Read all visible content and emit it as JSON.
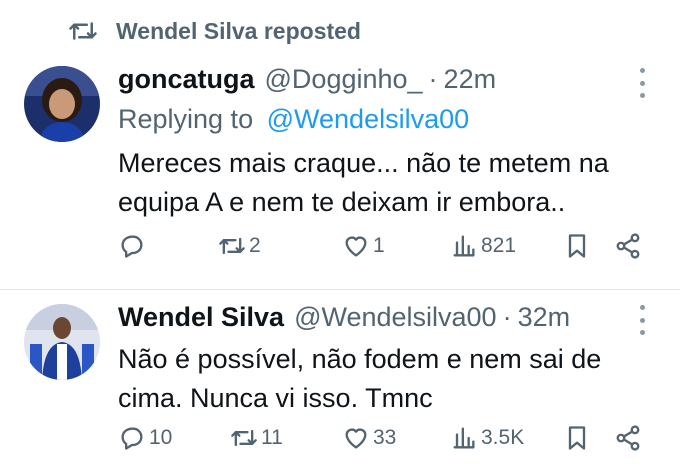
{
  "repost": {
    "text": "Wendel Silva reposted"
  },
  "tweets": [
    {
      "name": "goncatuga",
      "handle": "@Dogginho_",
      "separator": "·",
      "time": "22m",
      "replying_label": "Replying to",
      "replying_to": "@Wendelsilva00",
      "text_lines": [
        "Mereces mais craque... não te metem na",
        "equipa A e nem te deixam ir embora.."
      ],
      "replies": "",
      "reposts": "2",
      "likes": "1",
      "views": "821"
    },
    {
      "name": "Wendel Silva",
      "handle": "@Wendelsilva00",
      "separator": "·",
      "time": "32m",
      "text_lines": [
        "Não é possível, não fodem e nem sai de",
        "cima. Nunca vi isso. Tmnc"
      ],
      "replies": "10",
      "reposts": "11",
      "likes": "33",
      "views": "3.5K"
    }
  ],
  "icons": {
    "repost": "repost-icon",
    "reply": "reply-icon",
    "like": "heart-icon",
    "views": "views-icon",
    "bookmark": "bookmark-icon",
    "share": "share-icon",
    "more": "more-icon"
  },
  "colors": {
    "text": "#0f1419",
    "secondary": "#536471",
    "link": "#1d9bf0"
  }
}
